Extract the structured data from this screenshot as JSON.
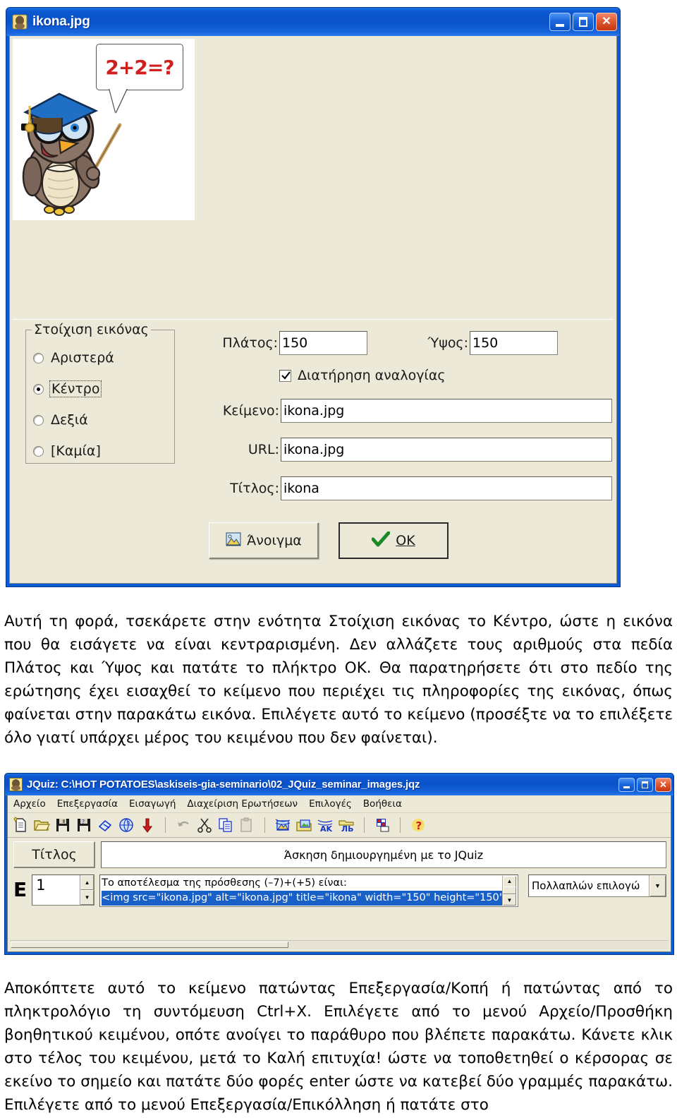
{
  "image_dialog": {
    "title": "ikona.jpg",
    "titlebar_icon": "image-file-icon",
    "window_buttons": {
      "minimize": "_",
      "maximize": "□",
      "close": "✕"
    },
    "preview": {
      "speech_bubble_text": "2+2=?",
      "alt": "cartoon owl teacher with pointer"
    },
    "alignment_group": {
      "legend": "Στοίχιση εικόνας",
      "options": [
        {
          "label": "Αριστερά",
          "selected": false
        },
        {
          "label": "Κέντρο",
          "selected": true
        },
        {
          "label": "Δεξιά",
          "selected": false
        },
        {
          "label": "[Καμία]",
          "selected": false
        }
      ]
    },
    "fields": {
      "width_label": "Πλάτος:",
      "width_value": "150",
      "height_label": "Ύψος:",
      "height_value": "150",
      "keep_ratio_label": "Διατήρηση αναλογίας",
      "keep_ratio_checked": true,
      "text_label": "Κείμενο:",
      "text_value": "ikona.jpg",
      "url_label": "URL:",
      "url_value": "ikona.jpg",
      "title_label": "Τίτλος:",
      "title_value": "ikona"
    },
    "buttons": {
      "open": "Άνοιγμα",
      "ok": "OK"
    }
  },
  "paragraphs": {
    "p1": "Αυτή τη φορά, τσεκάρετε στην ενότητα Στοίχιση εικόνας το Κέντρο, ώστε η εικόνα που θα εισάγετε να είναι κεντραρισμένη. Δεν αλλάζετε τους αριθμούς στα πεδία Πλάτος και Ύψος και πατάτε το πλήκτρο ΟΚ. Θα παρατηρήσετε ότι στο πεδίο της ερώτησης έχει εισαχθεί το κείμενο που περιέχει τις πληροφορίες της εικόνας, όπως φαίνεται στην παρακάτω εικόνα. Επιλέγετε αυτό το κείμενο (προσέξτε να το επιλέξετε όλο γιατί υπάρχει μέρος του κειμένου που δεν φαίνεται).",
    "p2": "Αποκόπτετε αυτό το κείμενο πατώντας Επεξεργασία/Κοπή ή πατώντας από το πληκτρολόγιο τη συντόμευση Ctrl+X. Επιλέγετε από το μενού Αρχείο/Προσθήκη βοηθητικού κειμένου, οπότε ανοίγει το παράθυρο που βλέπετε παρακάτω. Κάνετε κλικ στο τέλος του κειμένου, μετά το Καλή επιτυχία! ώστε να τοποθετηθεί ο κέρσορας σε εκείνο το σημείο και πατάτε δύο φορές enter ώστε να κατεβεί δύο γραμμές παρακάτω. Επιλέγετε από το μενού Επεξεργασία/Επικόλληση ή πατάτε στο"
  },
  "jquiz": {
    "title": "JQuiz: C:\\HOT POTATOES\\askiseis-gia-seminario\\02_JQuiz_seminar_images.jqz",
    "titlebar_icon": "hot-potatoes-icon",
    "window_buttons": {
      "minimize": "_",
      "maximize": "□",
      "close": "✕"
    },
    "menu": [
      "Αρχείο",
      "Επεξεργασία",
      "Εισαγωγή",
      "Διαχείριση Ερωτήσεων",
      "Επιλογές",
      "Βοήθεια"
    ],
    "toolbar_icons": [
      "new-file-icon",
      "open-folder-icon",
      "save-icon",
      "save-as-icon",
      "eraser-icon",
      "web-export-icon",
      "down-arrow-icon",
      "undo-icon",
      "cut-icon",
      "copy-icon",
      "paste-icon",
      "insert-picture-web-icon",
      "insert-picture-file-icon",
      "insert-link-web-icon",
      "insert-link-file-icon",
      "config-icon",
      "help-icon"
    ],
    "title_button": "Τίτλος",
    "title_value": "Άσκηση δημιουργημένη με το JQuiz",
    "question_prefix": "E",
    "question_number": "1",
    "spinner_up": "▲",
    "spinner_down": "▼",
    "question_line1": "Το αποτέλεσμα της πρόσθεσης (–7)+(+5) είναι:",
    "question_line2_selected": "<img src=\"ikona.jpg\" alt=\"ikona.jpg\" title=\"ikona\" width=\"150\" height=\"150\"",
    "scroll_up": "▲",
    "scroll_down": "▼",
    "question_type": "Πολλαπλών επιλογώ",
    "combo_arrow": "▼"
  },
  "colors": {
    "titlebar_blue": "#0a52c8",
    "dialog_face": "#ece9d8",
    "selection_blue": "#1860c8",
    "close_red": "#c4360f"
  }
}
